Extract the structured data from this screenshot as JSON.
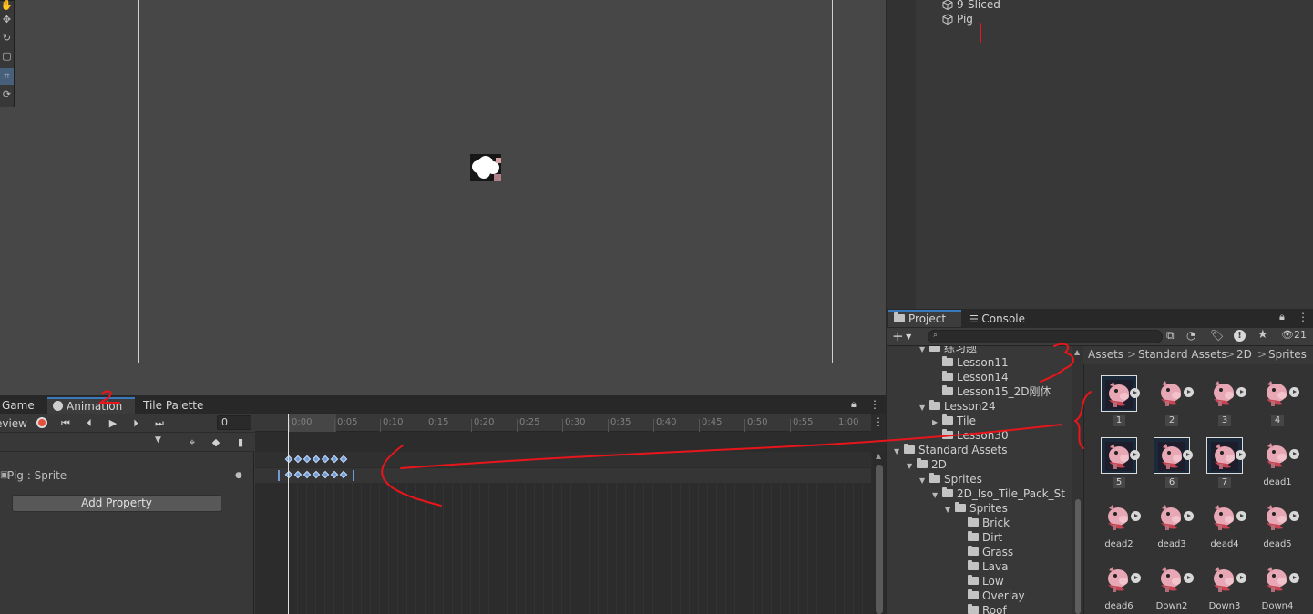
{
  "hierarchy": {
    "items": [
      {
        "label": "9-Sliced",
        "icon": "cube-icon"
      },
      {
        "label": "Pig",
        "icon": "cube-icon"
      }
    ]
  },
  "bottom_tabs": {
    "game": "Game",
    "animation": "Animation",
    "tile_palette": "Tile Palette"
  },
  "animation": {
    "preview_label": "Preview",
    "frame_value": "0",
    "property_label": "Pig : Sprite",
    "add_property_label": "Add Property",
    "timeline_ticks": [
      "0:00",
      "0:05",
      "0:10",
      "0:15",
      "0:20",
      "0:25",
      "0:30",
      "0:35",
      "0:40",
      "0:45",
      "0:50",
      "0:55",
      "1:00"
    ],
    "keyframe_count": 7
  },
  "project": {
    "tab_project": "Project",
    "tab_console": "Console",
    "hidden_count": "21",
    "breadcrumb": [
      "Assets",
      "Standard Assets",
      "2D",
      "Sprites"
    ],
    "tree": [
      {
        "label": "练习题",
        "indent": 2,
        "expand": "down"
      },
      {
        "label": "Lesson11",
        "indent": 3,
        "expand": ""
      },
      {
        "label": "Lesson14",
        "indent": 3,
        "expand": ""
      },
      {
        "label": "Lesson15_2D刚体",
        "indent": 3,
        "expand": ""
      },
      {
        "label": "Lesson24",
        "indent": 2,
        "expand": "down"
      },
      {
        "label": "Tile",
        "indent": 3,
        "expand": "right"
      },
      {
        "label": "Lesson30",
        "indent": 3,
        "expand": ""
      },
      {
        "label": "Standard Assets",
        "indent": 0,
        "expand": "down"
      },
      {
        "label": "2D",
        "indent": 1,
        "expand": "down"
      },
      {
        "label": "Sprites",
        "indent": 2,
        "expand": "down"
      },
      {
        "label": "2D_Iso_Tile_Pack_St",
        "indent": 3,
        "expand": "down"
      },
      {
        "label": "Sprites",
        "indent": 4,
        "expand": "down"
      },
      {
        "label": "Brick",
        "indent": 5,
        "expand": ""
      },
      {
        "label": "Dirt",
        "indent": 5,
        "expand": ""
      },
      {
        "label": "Grass",
        "indent": 5,
        "expand": ""
      },
      {
        "label": "Lava",
        "indent": 5,
        "expand": ""
      },
      {
        "label": "Low",
        "indent": 5,
        "expand": ""
      },
      {
        "label": "Overlay",
        "indent": 5,
        "expand": ""
      },
      {
        "label": "Roof",
        "indent": 5,
        "expand": ""
      }
    ],
    "assets": [
      {
        "label": "1",
        "type": "frame"
      },
      {
        "label": "2",
        "type": "pig"
      },
      {
        "label": "3",
        "type": "pig"
      },
      {
        "label": "4",
        "type": "pig"
      },
      {
        "label": "5",
        "type": "frame"
      },
      {
        "label": "6",
        "type": "frame"
      },
      {
        "label": "7",
        "type": "frame"
      },
      {
        "label": "dead1",
        "type": "pig"
      },
      {
        "label": "dead2",
        "type": "pig"
      },
      {
        "label": "dead3",
        "type": "pig"
      },
      {
        "label": "dead4",
        "type": "pig"
      },
      {
        "label": "dead5",
        "type": "pig"
      },
      {
        "label": "dead6",
        "type": "pig"
      },
      {
        "label": "Down2",
        "type": "pig"
      },
      {
        "label": "Down3",
        "type": "pig"
      },
      {
        "label": "Down4",
        "type": "pig"
      }
    ]
  },
  "annotations": {
    "labels": [
      "1",
      "2",
      "3"
    ],
    "color": "#e8151b"
  },
  "colors": {
    "accent_blue": "#3a79bb",
    "record_red": "#e2513b",
    "keyframe_blue": "#6f9bd8"
  }
}
